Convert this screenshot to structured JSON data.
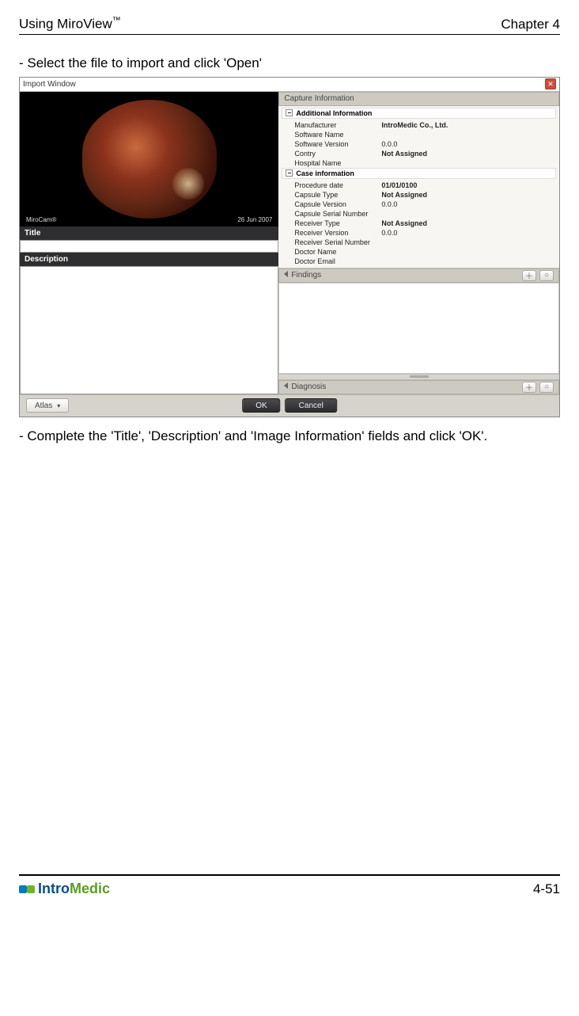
{
  "header": {
    "title": "Using MiroView",
    "superscript": "™",
    "chapter": "Chapter 4"
  },
  "text": {
    "step1": "- Select the file to import and click 'Open'",
    "step2": "- Complete the 'Title', 'Description' and 'Image Information' fields and click 'OK'."
  },
  "win": {
    "title": "Import Window"
  },
  "imageCaption": {
    "left": "MiroCam®",
    "right": "26 Jun 2007"
  },
  "leftPane": {
    "titleLabel": "Title",
    "descLabel": "Description"
  },
  "rightPane": {
    "captureHeader": "Capture Information",
    "group1": "Additional Information",
    "rows1": [
      {
        "k": "Manufacturer",
        "v": "IntroMedic Co., Ltd.",
        "bold": true
      },
      {
        "k": "Software Name",
        "v": ""
      },
      {
        "k": "Software Version",
        "v": "0.0.0"
      },
      {
        "k": "Contry",
        "v": "Not Assigned",
        "bold": true
      },
      {
        "k": "Hospital Name",
        "v": ""
      }
    ],
    "group2": "Case information",
    "rows2": [
      {
        "k": "Procedure date",
        "v": "01/01/0100",
        "bold": true
      },
      {
        "k": "Capsule Type",
        "v": "Not Assigned",
        "bold": true
      },
      {
        "k": "Capsule Version",
        "v": "0.0.0"
      },
      {
        "k": "Capsule Serial Number",
        "v": ""
      },
      {
        "k": "Receiver Type",
        "v": "Not Assigned",
        "bold": true
      },
      {
        "k": "Receiver Version",
        "v": "0.0.0"
      },
      {
        "k": "Receiver Serial Number",
        "v": ""
      },
      {
        "k": "Doctor Name",
        "v": ""
      },
      {
        "k": "Doctor Email",
        "v": ""
      }
    ],
    "findingsHeader": "Findings",
    "diagnosisHeader": "Diagnosis"
  },
  "bottom": {
    "atlas": "Atlas",
    "ok": "OK",
    "cancel": "Cancel"
  },
  "footer": {
    "brandA": "Intro",
    "brandB": "Medic",
    "page": "4-51"
  }
}
